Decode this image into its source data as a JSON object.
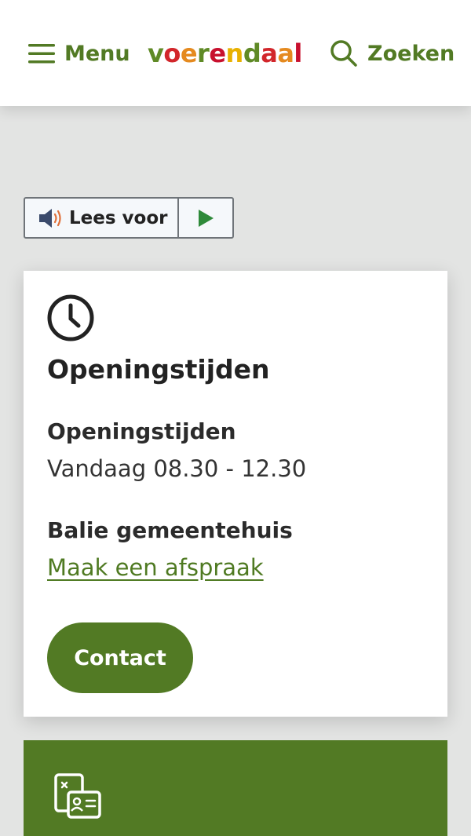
{
  "header": {
    "menu_label": "Menu",
    "logo": [
      {
        "ch": "v",
        "color": "#5f8a26"
      },
      {
        "ch": "o",
        "color": "#d2262b"
      },
      {
        "ch": "e",
        "color": "#e58a1f"
      },
      {
        "ch": "r",
        "color": "#5f8a26"
      },
      {
        "ch": "e",
        "color": "#c8102e"
      },
      {
        "ch": "n",
        "color": "#e8b100"
      },
      {
        "ch": "d",
        "color": "#5f8a26"
      },
      {
        "ch": "a",
        "color": "#d2262b"
      },
      {
        "ch": "a",
        "color": "#e58a1f"
      },
      {
        "ch": "l",
        "color": "#c8102e"
      }
    ],
    "search_label": "Zoeken"
  },
  "readspeaker": {
    "listen_label": "Lees voor"
  },
  "opening_card": {
    "title": "Openingstijden",
    "subtitle": "Openingstijden",
    "today_hours": "Vandaag 08.30 - 12.30",
    "balie_title": "Balie gemeentehuis",
    "appointment_link": "Maak een afspraak",
    "contact_button": "Contact"
  },
  "icons": {
    "menu": "hamburger-icon",
    "search": "search-icon",
    "speaker": "speaker-icon",
    "play": "play-icon",
    "clock": "clock-icon",
    "id_card": "id-card-icon"
  },
  "colors": {
    "brand_green": "#527a24",
    "page_background": "#e3e4e3",
    "text_dark": "#222222"
  }
}
